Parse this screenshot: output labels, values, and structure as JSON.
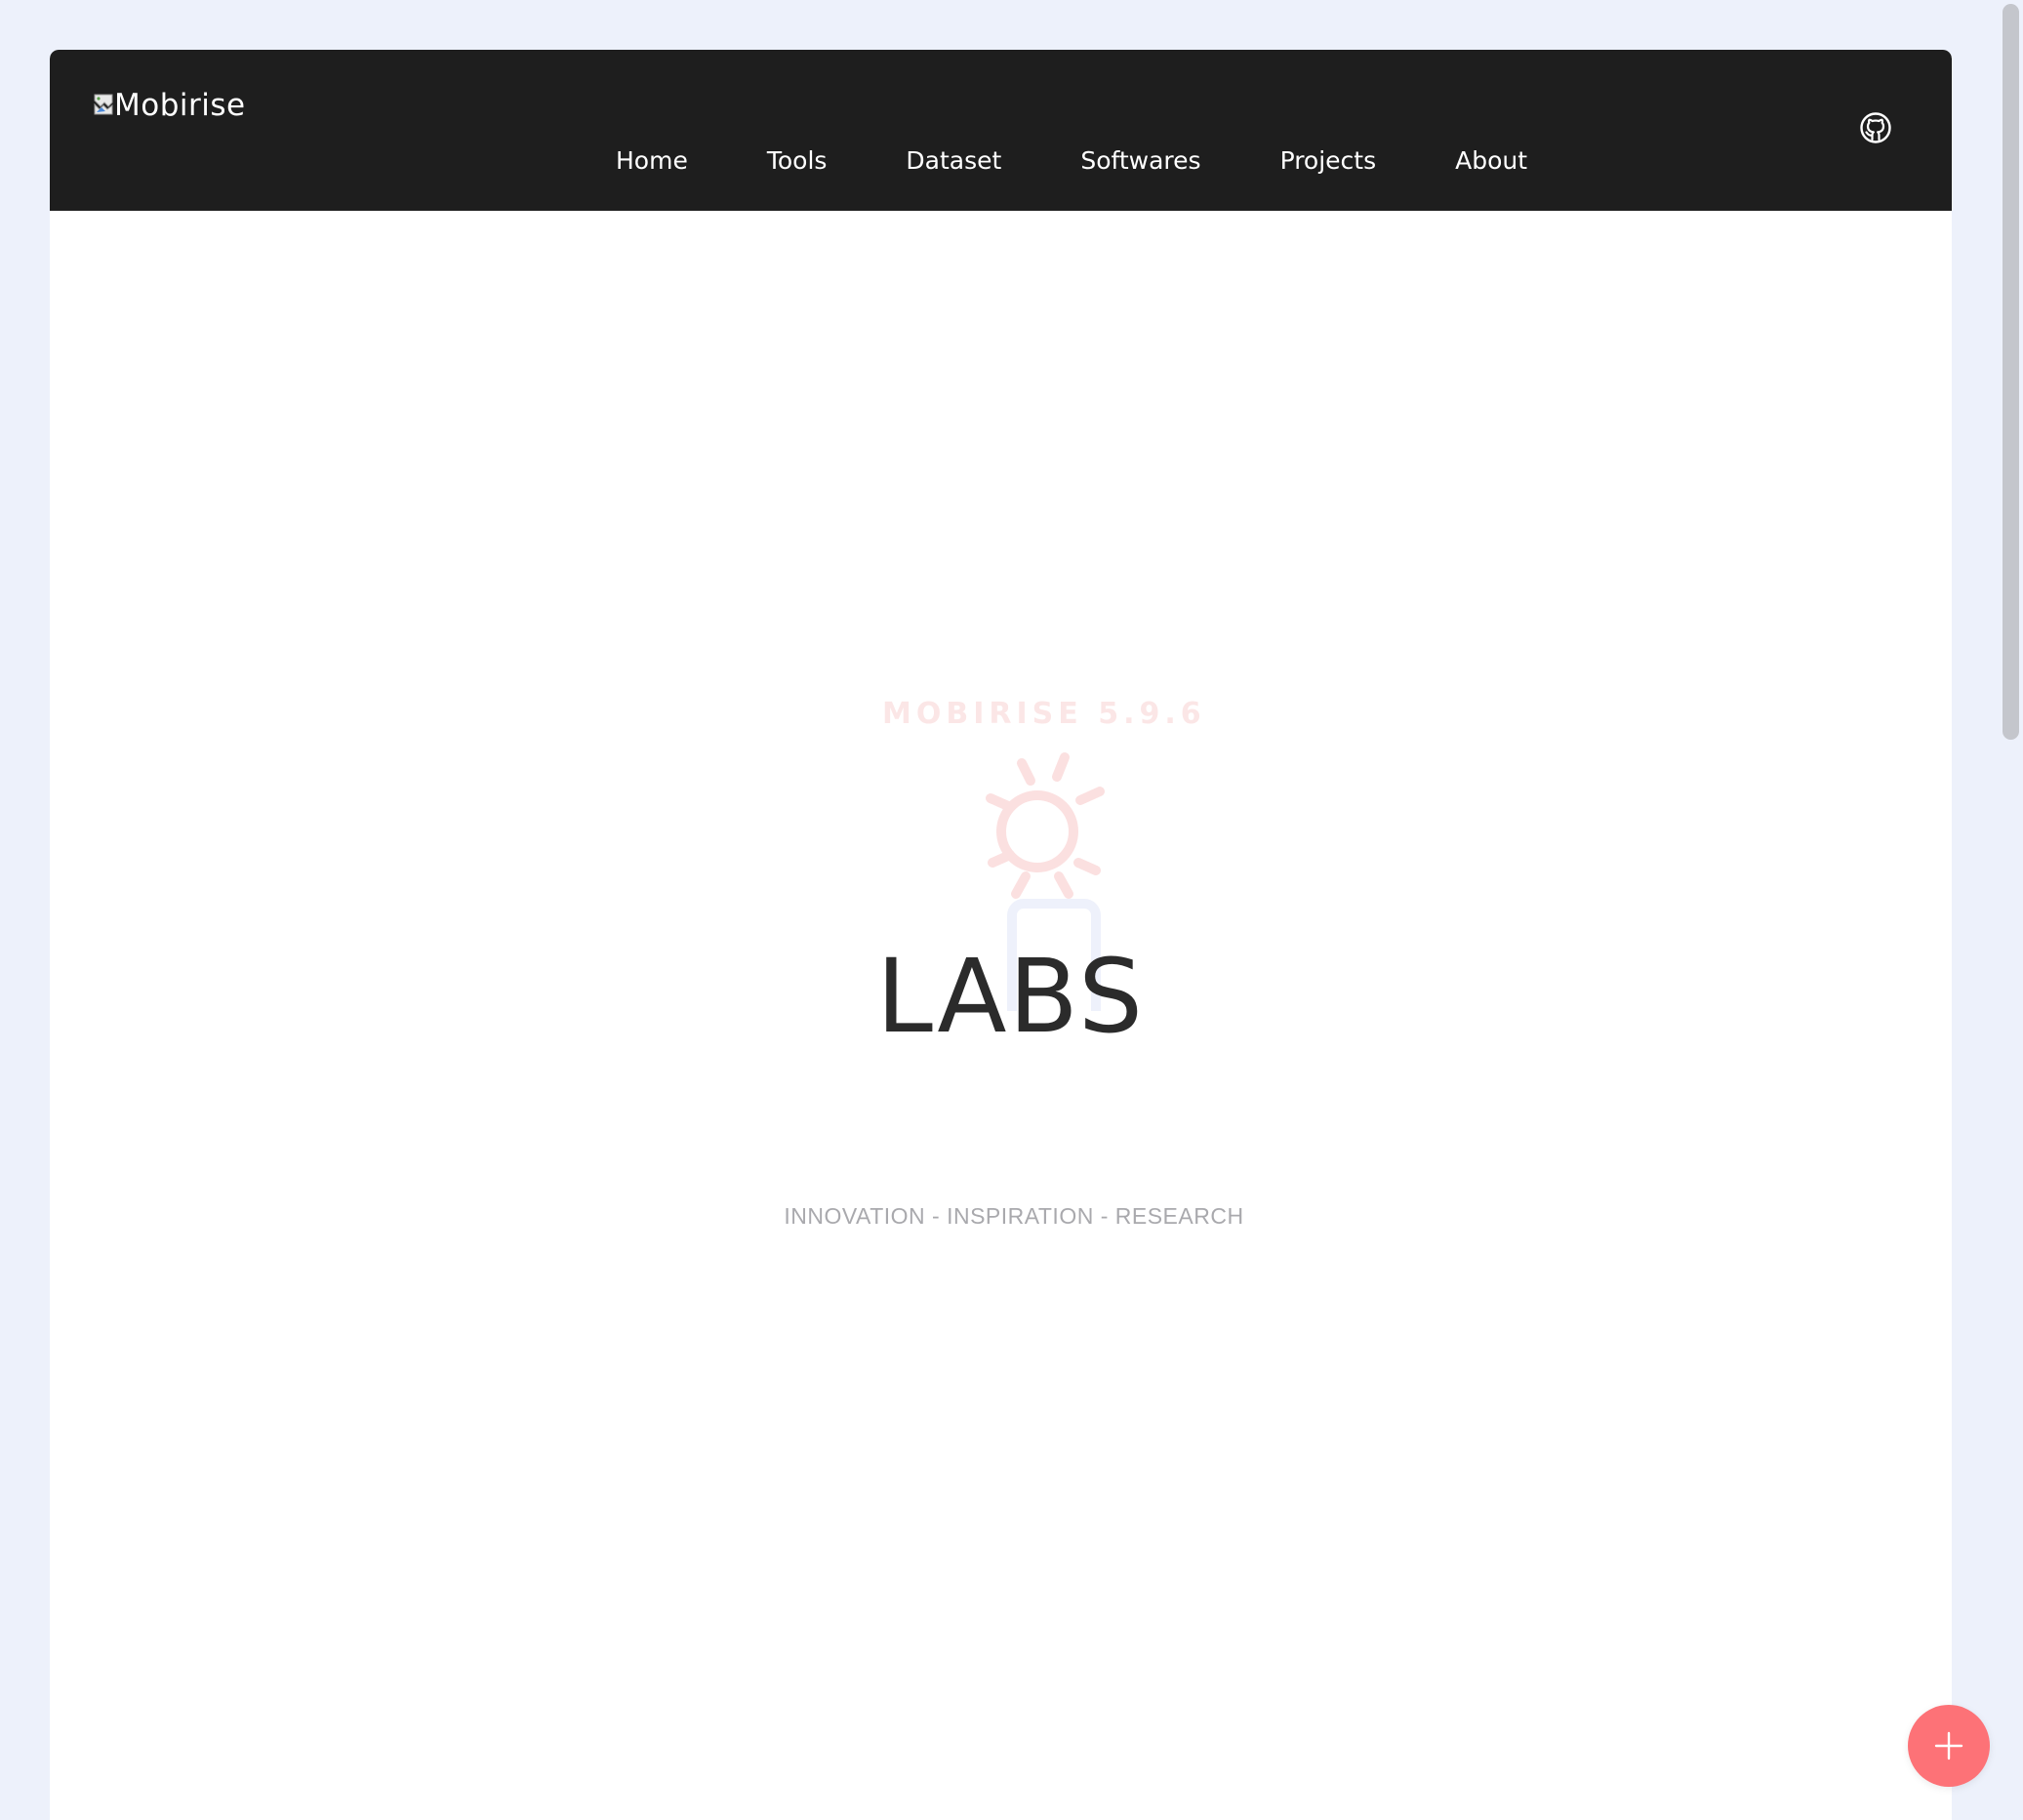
{
  "brand": {
    "logo_alt": "Mobirise"
  },
  "nav": {
    "items": [
      {
        "label": "Home"
      },
      {
        "label": "Tools"
      },
      {
        "label": "Dataset"
      },
      {
        "label": "Softwares"
      },
      {
        "label": "Projects"
      },
      {
        "label": "About"
      }
    ],
    "github_icon": "github-icon"
  },
  "watermark": {
    "text": "MOBIRISE  5.9.6"
  },
  "hero": {
    "title": "LABS",
    "subtitle": "INNOVATION - INSPIRATION - RESEARCH"
  },
  "fab": {
    "icon": "plus-icon"
  },
  "colors": {
    "navbar_bg": "#1e1e1e",
    "page_bg": "#edf1fb",
    "fab_bg": "#fd7277",
    "title_text": "#2b2b2b",
    "subtitle_text": "#a9a9ad"
  }
}
